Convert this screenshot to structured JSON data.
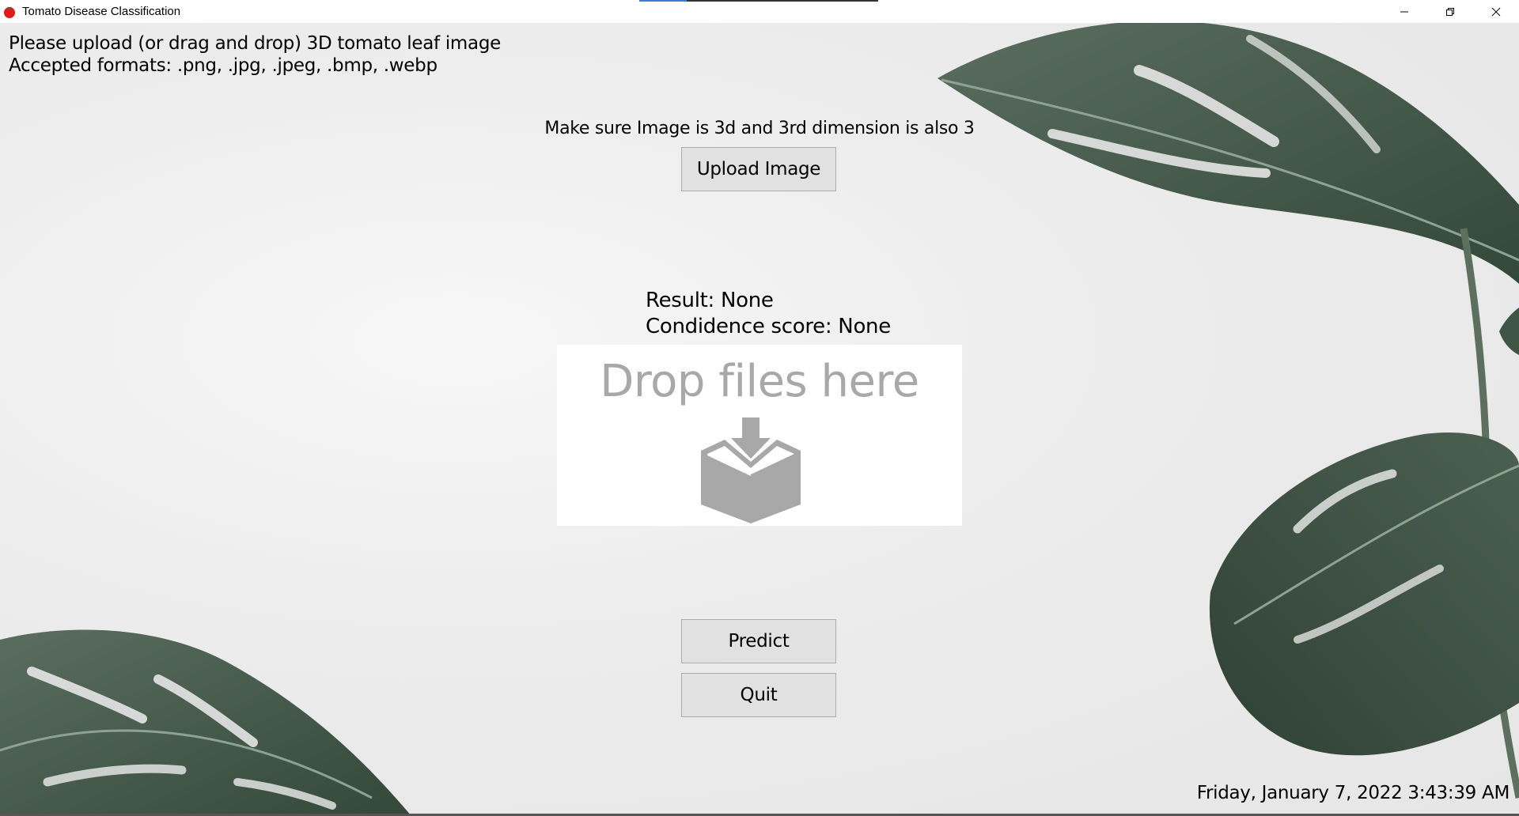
{
  "window": {
    "title": "Tomato Disease Classification",
    "icon": "tomato-icon",
    "controls": [
      "minimize-icon",
      "restore-icon",
      "close-icon"
    ]
  },
  "instructions": {
    "line1": "Please upload (or drag and drop) 3D tomato leaf image",
    "line2": "Accepted formats: .png, .jpg, .jpeg, .bmp, .webp"
  },
  "hint": "Make sure Image is 3d and 3rd dimension is also 3",
  "buttons": {
    "upload": "Upload Image",
    "predict": "Predict",
    "quit": "Quit"
  },
  "result": {
    "result_line": "Result: None",
    "score_line": "Condidence score: None"
  },
  "dropzone": {
    "text": "Drop files here",
    "icon": "drop-files-icon"
  },
  "datetime": "Friday, January 7, 2022 3:43:39 AM",
  "colors": {
    "tomato": "#e01b1b",
    "leaf_dark": "#3f5545",
    "leaf_mid": "#55695a",
    "button_bg": "#e1e1e1",
    "drop_gray": "#a8a8a8"
  }
}
